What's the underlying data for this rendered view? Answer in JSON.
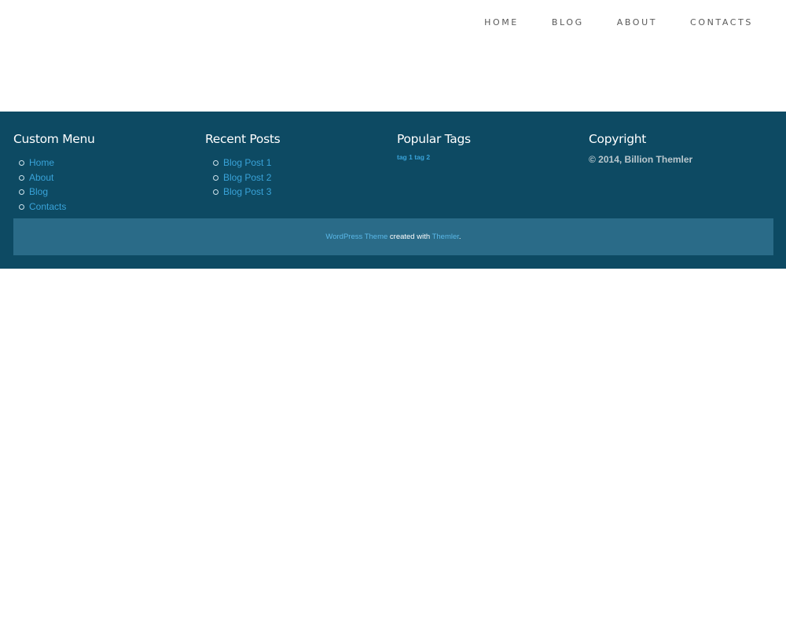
{
  "nav": {
    "items": [
      {
        "label": "HOME"
      },
      {
        "label": "BLOG"
      },
      {
        "label": "ABOUT"
      },
      {
        "label": "CONTACTS"
      }
    ]
  },
  "footer": {
    "custom_menu": {
      "title": "Custom Menu",
      "items": [
        {
          "label": "Home"
        },
        {
          "label": "About"
        },
        {
          "label": "Blog"
        },
        {
          "label": "Contacts"
        }
      ]
    },
    "recent_posts": {
      "title": "Recent Posts",
      "items": [
        {
          "label": "Blog Post 1"
        },
        {
          "label": "Blog Post 2"
        },
        {
          "label": "Blog Post 3"
        }
      ]
    },
    "popular_tags": {
      "title": "Popular Tags",
      "tags": [
        {
          "label": "tag 1"
        },
        {
          "label": "tag 2"
        }
      ]
    },
    "copyright": {
      "title": "Copyright",
      "text": "© 2014, Billion Themler"
    },
    "credits": {
      "link1": "WordPress Theme",
      "middle": " created with ",
      "link2": "Themler",
      "end": "."
    }
  },
  "colors": {
    "footer_bg": "#0d4a63",
    "credits_bg": "#2a6b88",
    "link": "#39a3d9",
    "nav_text": "#5a5a5a"
  }
}
